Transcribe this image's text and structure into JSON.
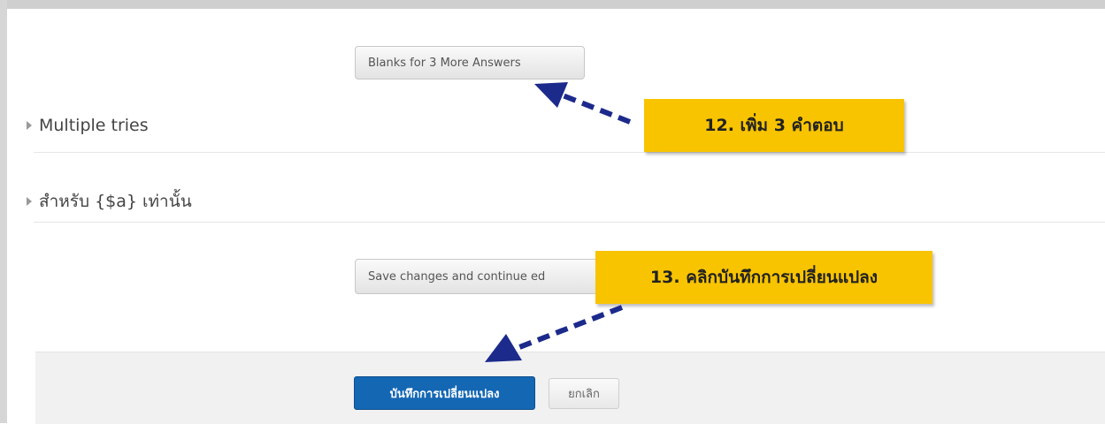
{
  "form": {
    "blanks_button": "Blanks for 3 More Answers",
    "section_multiple_tries": "Multiple tries",
    "section_for_a": "สำหรับ {$a} เท่านั้น",
    "save_continue_button": "Save changes and continue ed",
    "save_button": "บันทึกการเปลี่ยนแปลง",
    "cancel_button": "ยกเลิก"
  },
  "annotations": {
    "step12": "12. เพิ่ม 3 คำตอบ",
    "step13": "13. คลิกบันทึกการเปลี่ยนแปลง"
  },
  "colors": {
    "note_bg": "#f8c400",
    "arrow": "#1c2a8c",
    "primary_button": "#1467b3"
  }
}
